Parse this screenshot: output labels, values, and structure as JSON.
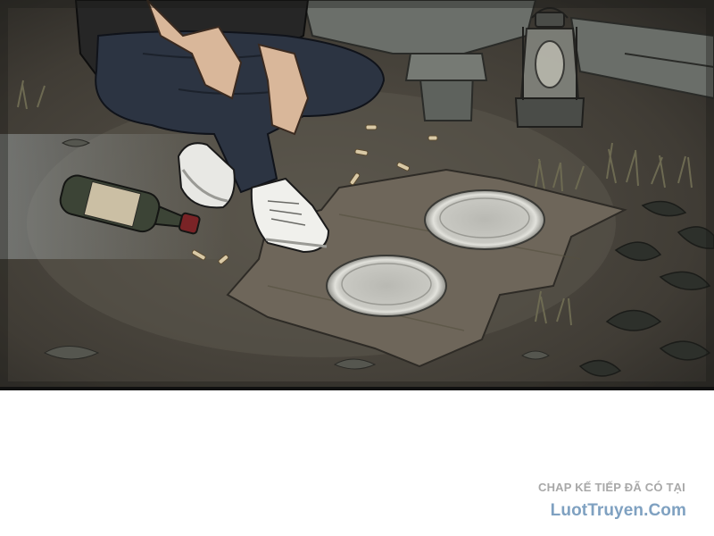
{
  "footer": {
    "next_chapter_note": "CHAP KẾ TIẾP ĐÃ CÓ TẠI",
    "site_name": "LuotTruyen.Com"
  },
  "colors": {
    "ground": "#4a463f",
    "cloth": "#6e665a",
    "plate": "#cfcfc9",
    "jeans": "#2c3442",
    "jacket": "#262626",
    "site_link": "#7fa1c1",
    "note_text": "#a8a8a8"
  }
}
